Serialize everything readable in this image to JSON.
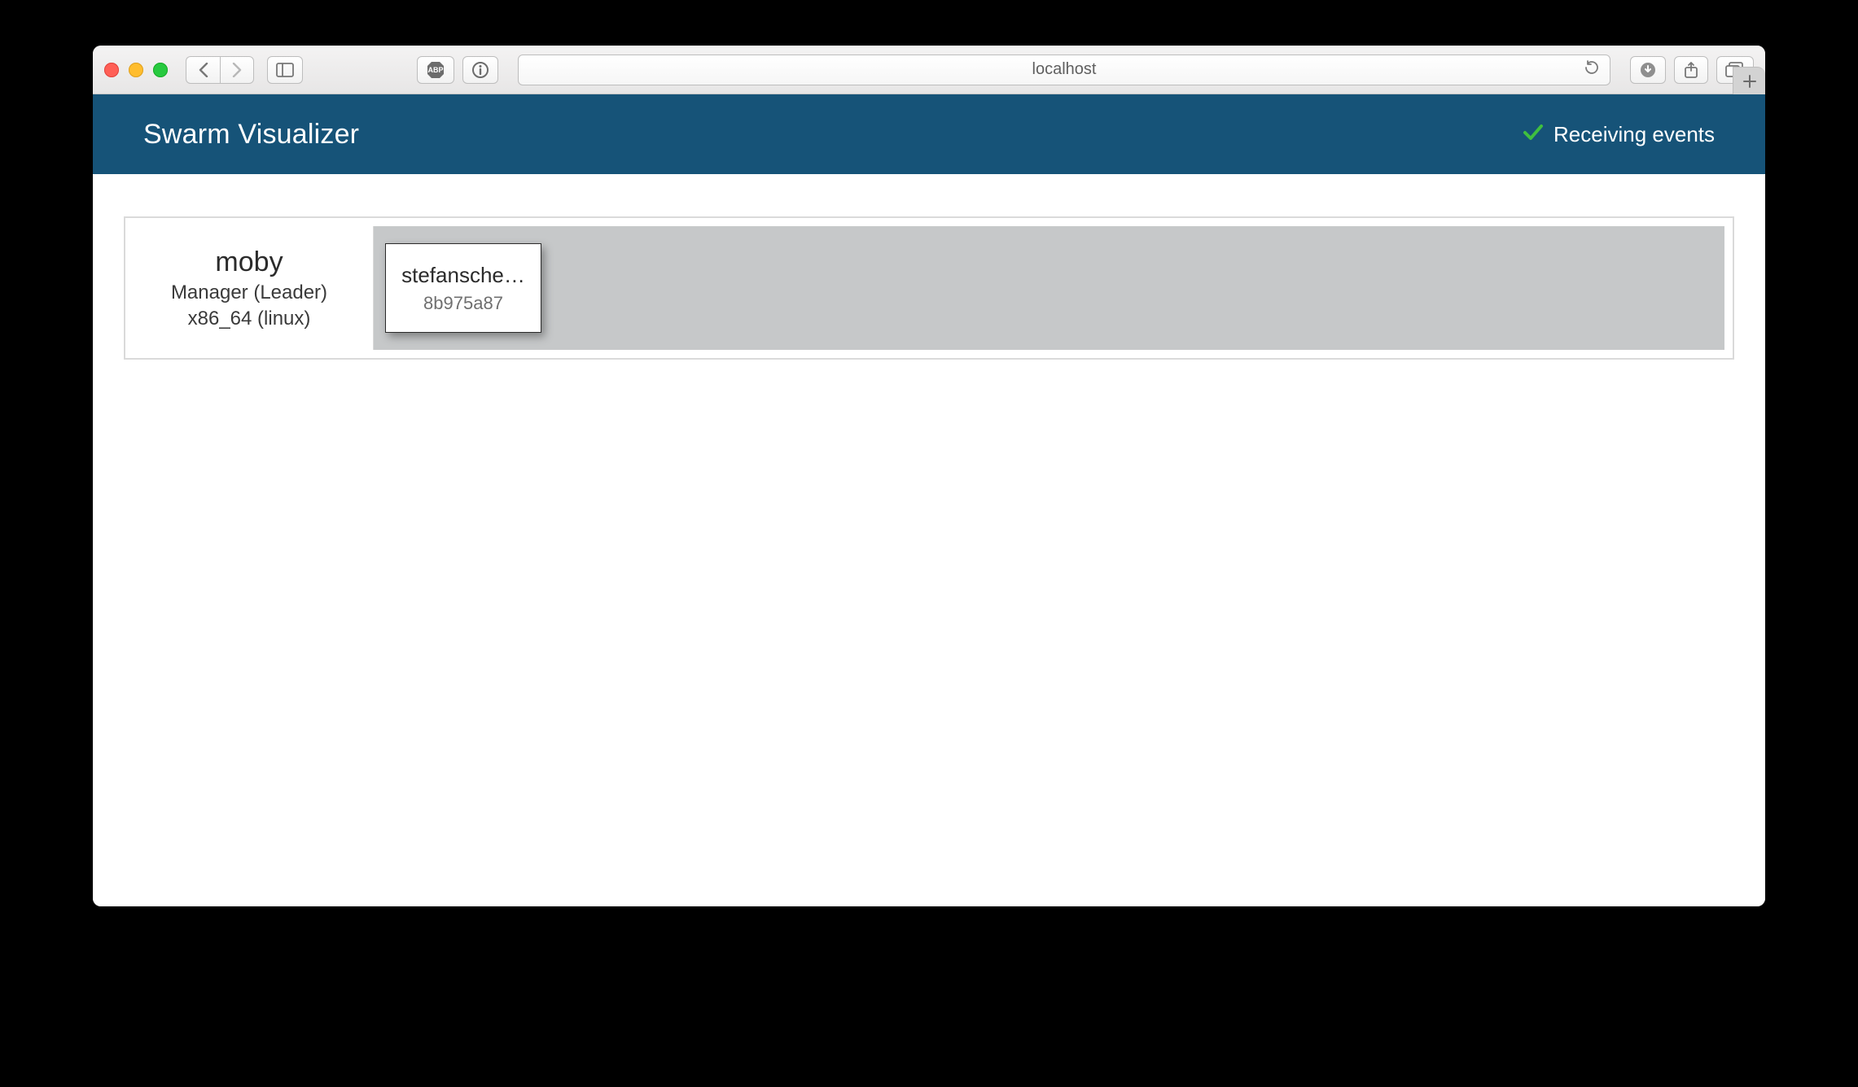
{
  "browser": {
    "address": "localhost"
  },
  "app": {
    "title": "Swarm Visualizer",
    "status_text": "Receiving events"
  },
  "node": {
    "name": "moby",
    "role": "Manager (Leader)",
    "arch": "x86_64 (linux)"
  },
  "services": [
    {
      "name": "stefansche…",
      "id": "8b975a87"
    }
  ]
}
